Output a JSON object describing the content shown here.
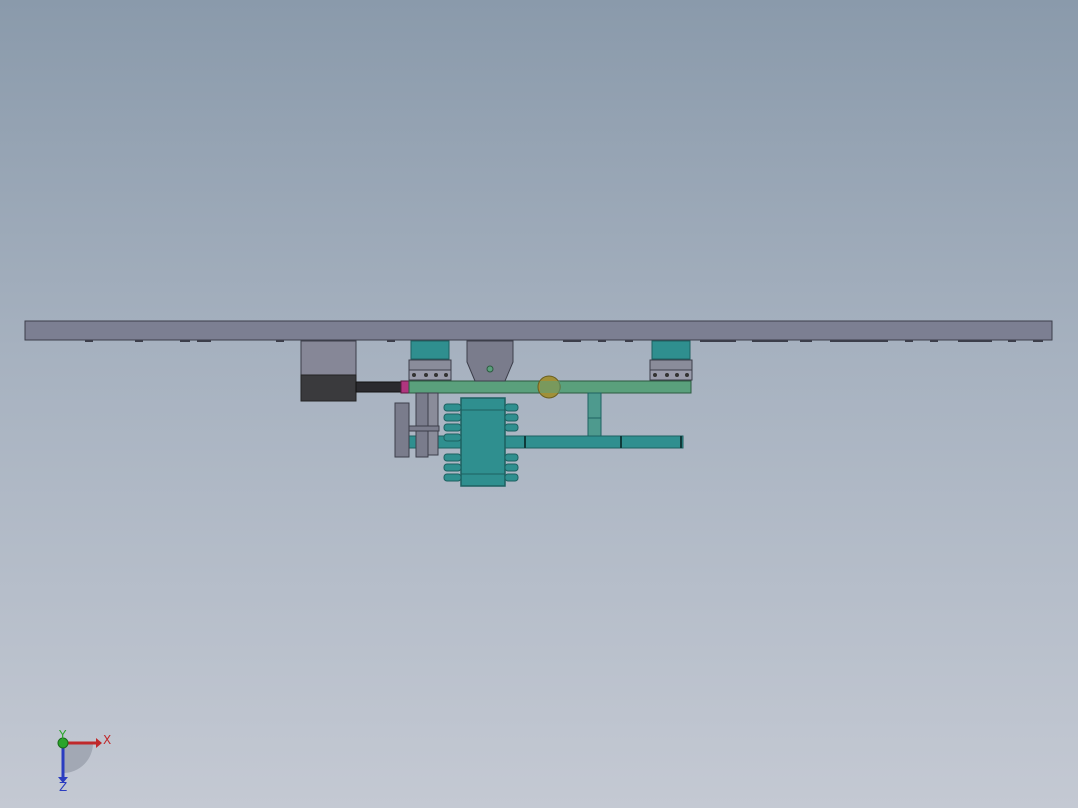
{
  "viewport": {
    "background_top": "#8a9aab",
    "background_bottom": "#c4c9d3"
  },
  "model": {
    "colors": {
      "plate": "#7c7f92",
      "plate_edge": "#3c3e4a",
      "motor_light": "#868797",
      "motor_dark": "#3a3a3d",
      "rail": "#5aa07c",
      "rail_edge": "#2c5a40",
      "teal": "#2f8f8f",
      "teal_dark": "#1d6161",
      "bracket": "#7a7c8c",
      "coupler": "#b0357f",
      "knob": "#a09038"
    }
  },
  "triad": {
    "x_label": "X",
    "y_label": "Y",
    "z_label": "Z",
    "x_color": "#c0282a",
    "y_color": "#2aa52a",
    "z_color": "#2a3cc0"
  }
}
